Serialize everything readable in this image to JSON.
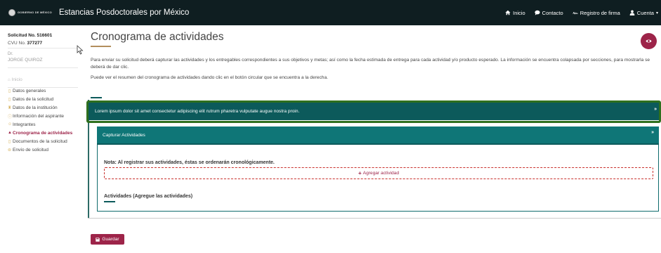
{
  "header": {
    "logo_text": "GOBIERNO DE MÉXICO",
    "app_title": "Estancias Posdoctorales por México",
    "nav": [
      {
        "label": "Inicio",
        "icon": "home-icon"
      },
      {
        "label": "Contacto",
        "icon": "chat-icon"
      },
      {
        "label": "Registro de firma",
        "icon": "signature-icon"
      },
      {
        "label": "Cuenta",
        "icon": "user-icon"
      }
    ]
  },
  "sidebar": {
    "title": "Solicitud No. 516601",
    "cvu_label": "CVU No.",
    "cvu_value": "377277",
    "prefix": "Dr.",
    "name": "JORGE QUIROZ",
    "home": "Inicio",
    "items": [
      {
        "label": "Datos generales",
        "icon": "document-icon"
      },
      {
        "label": "Datos de la solicitud",
        "icon": "document-icon"
      },
      {
        "label": "Datos de la institución",
        "icon": "institution-icon"
      },
      {
        "label": "Información del aspirante",
        "icon": "info-icon"
      },
      {
        "label": "Integrantes",
        "icon": "group-icon"
      },
      {
        "label": "Cronograma de actividades",
        "icon": "warning-icon",
        "active": true
      },
      {
        "label": "Documentos de la solicitud",
        "icon": "folder-icon"
      },
      {
        "label": "Envío de solicitud",
        "icon": "send-icon"
      }
    ]
  },
  "main": {
    "title": "Cronograma de actividades",
    "paragraph1": "Para enviar su solicitud deberá capturar las actividades y los entregables correspondientes a sus objetivos y metas; así como la fecha estimada de entrega para cada actividad y/o producto esperado. La información se encuentra colapsada por secciones, para mostrarla se deberá de dar clic.",
    "paragraph2": "Puede ver el resumen del cronograma de actividades dando clic en el botón circular que se encuentra a la derecha.",
    "outer_panel_title": "Lorem ipsum dolor sit amet consectetur adipiscing elit rutrum pharetra vulputate augue nostra proin.",
    "inner_panel_title": "Capturar Actividades",
    "note": "Nota: Al registrar sus actividades, éstas se ordenarán cronológicamente.",
    "add_button": "Agregar actividad",
    "activities_title": "Actividades (Agregue las actividades)",
    "save_button": "Guardar"
  },
  "colors": {
    "topbar": "#0f1e21",
    "accent": "#9d2449",
    "teal": "#0c5a5b",
    "gold": "#b38e5d"
  }
}
